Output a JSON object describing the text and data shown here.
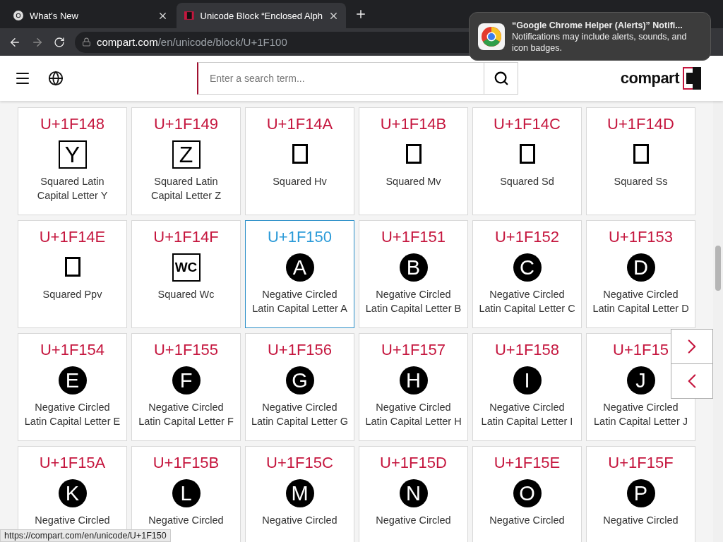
{
  "browser": {
    "tabs": [
      {
        "title": "What's New",
        "selected": false,
        "kind": "chrome"
      },
      {
        "title": "Unicode Block “Enclosed Alph",
        "selected": true,
        "kind": "site"
      }
    ],
    "address": {
      "host": "compart.com",
      "path": "/en/unicode/block/U+1F100"
    }
  },
  "notification": {
    "title": "“Google Chrome Helper (Alerts)” Notifi...",
    "body": "Notifications may include alerts, sounds, and icon badges."
  },
  "header": {
    "search": {
      "placeholder": "Enter a search term..."
    },
    "logo": "compart"
  },
  "cards": [
    {
      "code": "U+1F148",
      "kind": "squared",
      "glyph": "Y",
      "name": "Squared Latin\nCapital Letter Y",
      "selected": false
    },
    {
      "code": "U+1F149",
      "kind": "squared",
      "glyph": "Z",
      "name": "Squared Latin\nCapital Letter Z",
      "selected": false
    },
    {
      "code": "U+1F14A",
      "kind": "missing",
      "name": "Squared Hv",
      "selected": false
    },
    {
      "code": "U+1F14B",
      "kind": "missing",
      "name": "Squared Mv",
      "selected": false
    },
    {
      "code": "U+1F14C",
      "kind": "missing",
      "name": "Squared Sd",
      "selected": false
    },
    {
      "code": "U+1F14D",
      "kind": "missing",
      "name": "Squared Ss",
      "selected": false
    },
    {
      "code": "U+1F14E",
      "kind": "missing",
      "name": "Squared Ppv",
      "selected": false
    },
    {
      "code": "U+1F14F",
      "kind": "squared",
      "glyph": "WC",
      "name": "Squared Wc",
      "selected": false
    },
    {
      "code": "U+1F150",
      "kind": "circled",
      "glyph": "A",
      "name": "Negative Circled\nLatin Capital Letter A",
      "selected": true
    },
    {
      "code": "U+1F151",
      "kind": "circled",
      "glyph": "B",
      "name": "Negative Circled\nLatin Capital Letter B",
      "selected": false
    },
    {
      "code": "U+1F152",
      "kind": "circled",
      "glyph": "C",
      "name": "Negative Circled\nLatin Capital Letter C",
      "selected": false
    },
    {
      "code": "U+1F153",
      "kind": "circled",
      "glyph": "D",
      "name": "Negative Circled\nLatin Capital Letter D",
      "selected": false
    },
    {
      "code": "U+1F154",
      "kind": "circled",
      "glyph": "E",
      "name": "Negative Circled\nLatin Capital Letter E",
      "selected": false
    },
    {
      "code": "U+1F155",
      "kind": "circled",
      "glyph": "F",
      "name": "Negative Circled\nLatin Capital Letter F",
      "selected": false
    },
    {
      "code": "U+1F156",
      "kind": "circled",
      "glyph": "G",
      "name": "Negative Circled\nLatin Capital Letter G",
      "selected": false
    },
    {
      "code": "U+1F157",
      "kind": "circled",
      "glyph": "H",
      "name": "Negative Circled\nLatin Capital Letter H",
      "selected": false
    },
    {
      "code": "U+1F158",
      "kind": "circled",
      "glyph": "I",
      "name": "Negative Circled\nLatin Capital Letter I",
      "selected": false
    },
    {
      "code": "U+1F15",
      "kind": "circled",
      "glyph": "J",
      "name": "Negative Circled\nLatin Capital Letter J",
      "selected": false
    },
    {
      "code": "U+1F15A",
      "kind": "circled",
      "glyph": "K",
      "name": "Negative Circled",
      "selected": false
    },
    {
      "code": "U+1F15B",
      "kind": "circled",
      "glyph": "L",
      "name": "Negative Circled",
      "selected": false
    },
    {
      "code": "U+1F15C",
      "kind": "circled",
      "glyph": "M",
      "name": "Negative Circled",
      "selected": false
    },
    {
      "code": "U+1F15D",
      "kind": "circled",
      "glyph": "N",
      "name": "Negative Circled",
      "selected": false
    },
    {
      "code": "U+1F15E",
      "kind": "circled",
      "glyph": "O",
      "name": "Negative Circled",
      "selected": false
    },
    {
      "code": "U+1F15F",
      "kind": "circled",
      "glyph": "P",
      "name": "Negative Circled",
      "selected": false
    }
  ],
  "status_bar": {
    "url": "https://compart.com/en/unicode/U+1F150"
  }
}
